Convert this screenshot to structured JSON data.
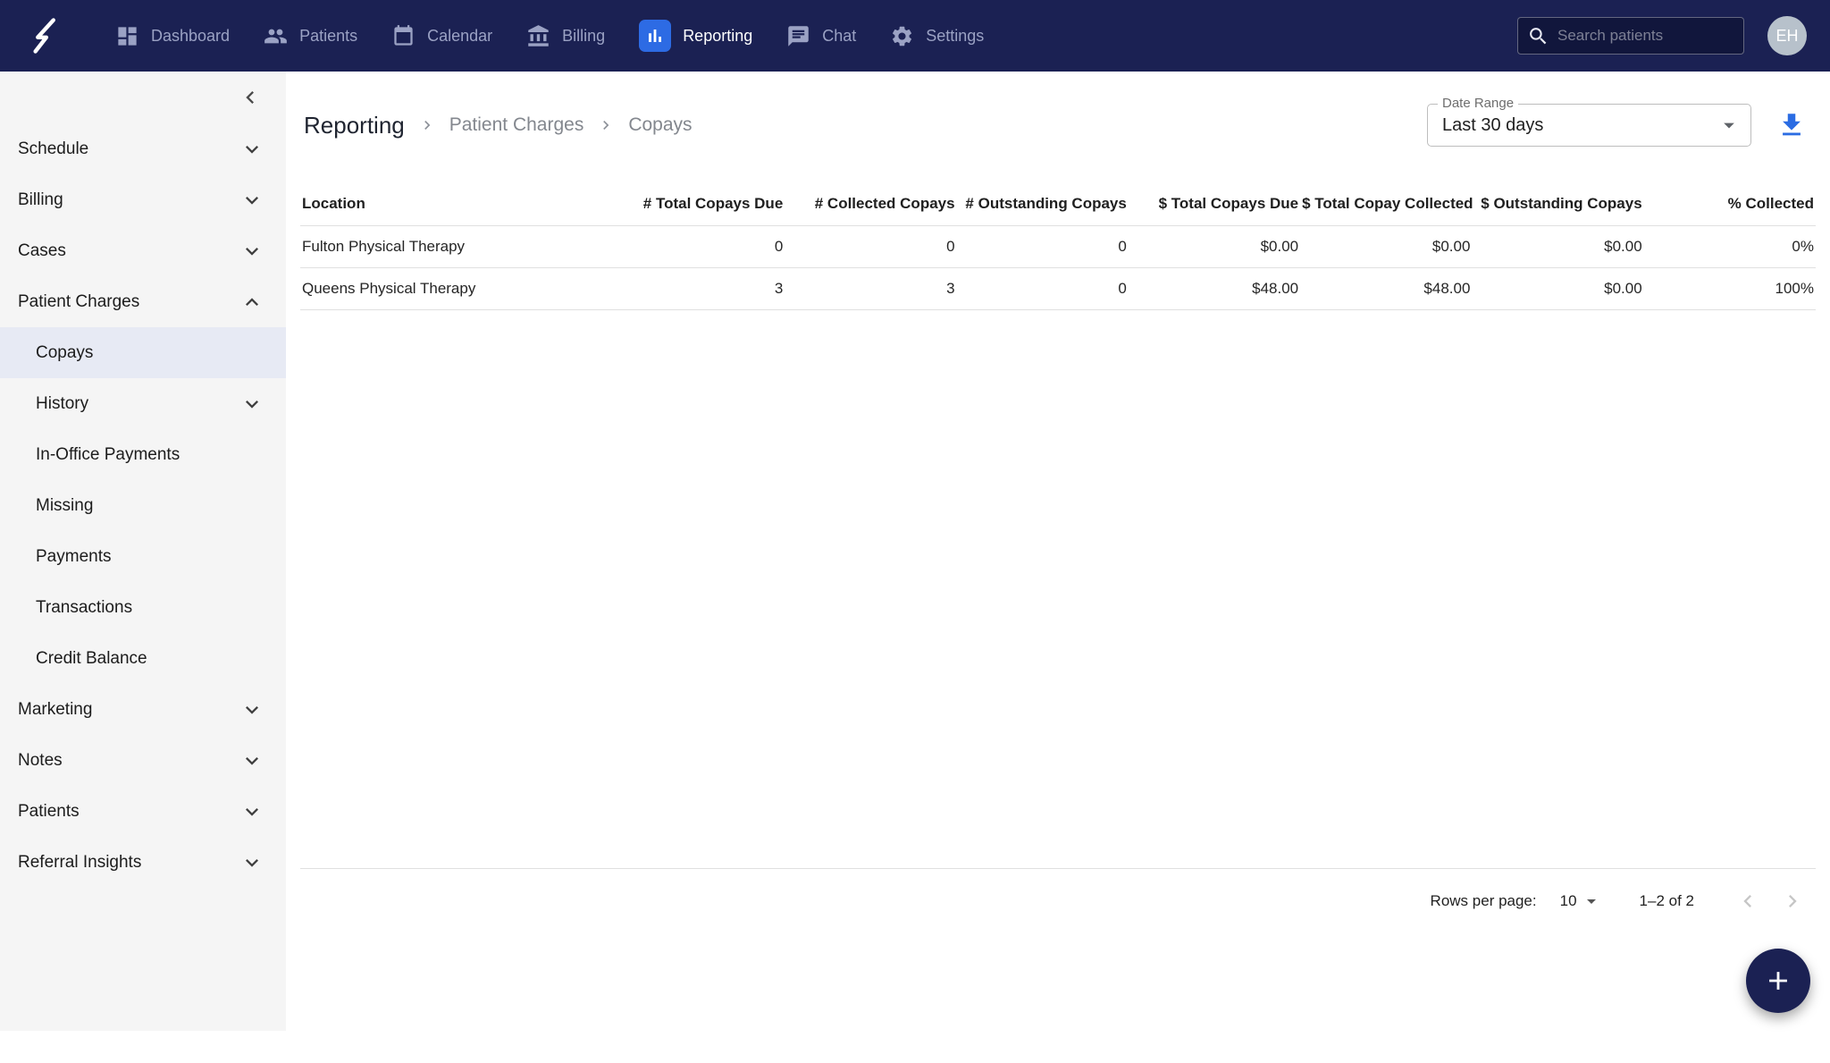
{
  "topbar": {
    "nav": [
      {
        "label": "Dashboard",
        "icon": "dashboard-icon",
        "active": false
      },
      {
        "label": "Patients",
        "icon": "patients-icon",
        "active": false
      },
      {
        "label": "Calendar",
        "icon": "calendar-icon",
        "active": false
      },
      {
        "label": "Billing",
        "icon": "bank-icon",
        "active": false
      },
      {
        "label": "Reporting",
        "icon": "bar-chart-icon",
        "active": true
      },
      {
        "label": "Chat",
        "icon": "chat-icon",
        "active": false
      },
      {
        "label": "Settings",
        "icon": "gear-icon",
        "active": false
      }
    ],
    "search_placeholder": "Search patients",
    "avatar_initials": "EH"
  },
  "sidebar": {
    "items": [
      {
        "label": "Schedule"
      },
      {
        "label": "Billing"
      },
      {
        "label": "Cases"
      },
      {
        "label": "Patient Charges",
        "expanded": true
      }
    ],
    "children": [
      {
        "label": "Copays",
        "selected": true
      },
      {
        "label": "History"
      },
      {
        "label": "In-Office Payments"
      },
      {
        "label": "Missing"
      },
      {
        "label": "Payments"
      },
      {
        "label": "Transactions"
      },
      {
        "label": "Credit Balance"
      }
    ],
    "items_after": [
      {
        "label": "Marketing"
      },
      {
        "label": "Notes"
      },
      {
        "label": "Patients"
      },
      {
        "label": "Referral Insights"
      }
    ]
  },
  "breadcrumb": {
    "items": [
      "Reporting",
      "Patient Charges",
      "Copays"
    ]
  },
  "filters": {
    "date_range_label": "Date Range",
    "date_range_value": "Last 30 days"
  },
  "table": {
    "columns": [
      "Location",
      "# Total Copays Due",
      "# Collected Copays",
      "# Outstanding Copays",
      "$ Total Copays Due",
      "$ Total Copay Collected",
      "$ Outstanding Copays",
      "% Collected"
    ],
    "rows": [
      [
        "Fulton Physical Therapy",
        "0",
        "0",
        "0",
        "$0.00",
        "$0.00",
        "$0.00",
        "0%"
      ],
      [
        "Queens Physical Therapy",
        "3",
        "3",
        "0",
        "$48.00",
        "$48.00",
        "$0.00",
        "100%"
      ]
    ]
  },
  "pagination": {
    "rows_per_page_label": "Rows per page:",
    "rows_per_page_value": "10",
    "range": "1–2 of 2"
  },
  "colors": {
    "topbar_bg": "#1B2153",
    "accent_blue": "#2D6BE4",
    "sidebar_bg": "#F5F5F5",
    "selected_item_bg": "#E7EAF4",
    "fab_bg": "#1B2153"
  }
}
